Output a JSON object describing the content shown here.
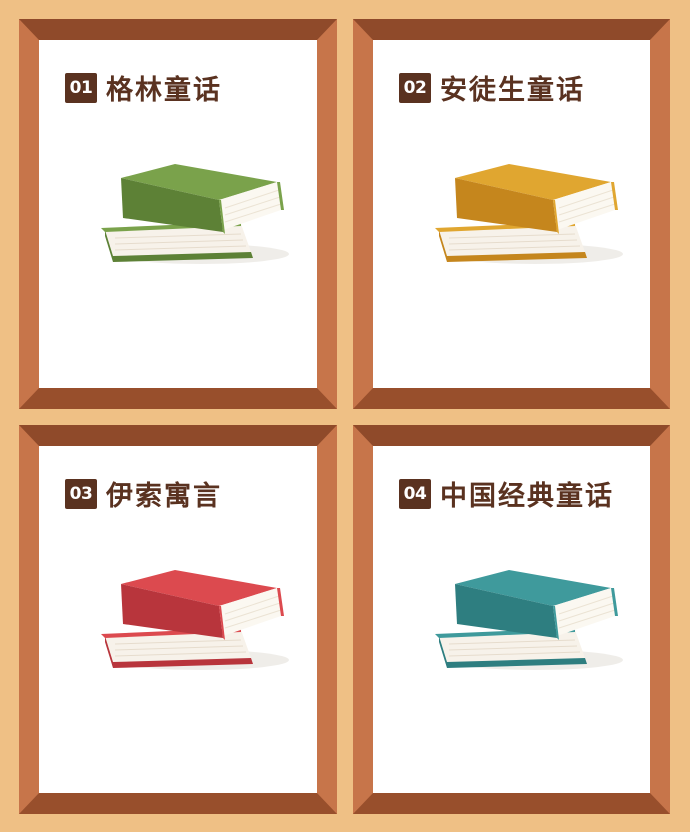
{
  "cards": [
    {
      "number": "01",
      "title": "格林童话",
      "book_color": "#7aa24b",
      "book_shadow": "#5d8136"
    },
    {
      "number": "02",
      "title": "安徒生童话",
      "book_color": "#e0a630",
      "book_shadow": "#c5861d"
    },
    {
      "number": "03",
      "title": "伊索寓言",
      "book_color": "#dc4a4f",
      "book_shadow": "#b8353c"
    },
    {
      "number": "04",
      "title": "中国经典童话",
      "book_color": "#3f9a9c",
      "book_shadow": "#2e7e80"
    }
  ]
}
